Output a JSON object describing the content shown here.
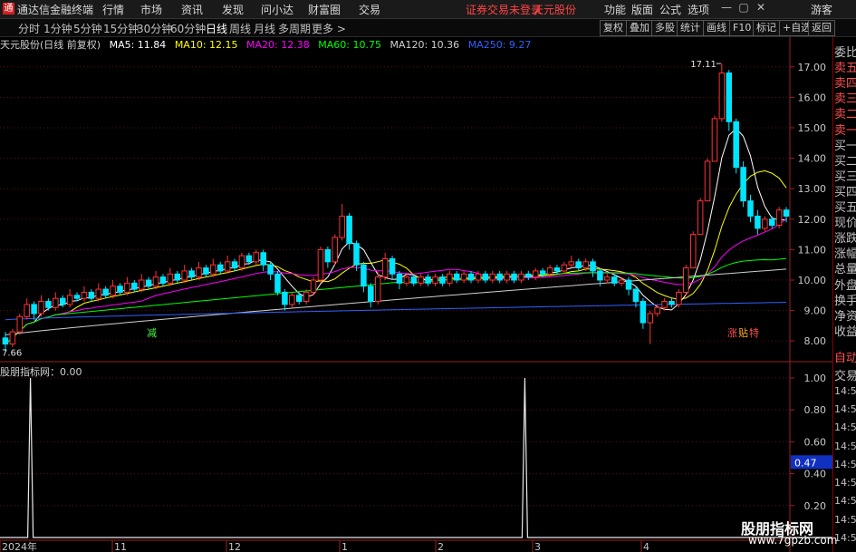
{
  "app": {
    "logo_glyph": "通",
    "title": "通达信金融终端",
    "menu": [
      "行情",
      "市场",
      "资讯",
      "发现",
      "问小达",
      "财富圈",
      "交易"
    ],
    "notice": "证券交易未登录",
    "stock_name_top": "天元股份",
    "right_menu": [
      "功能",
      "版面",
      "公式",
      "选项"
    ],
    "guest": "游客",
    "win_buttons": [
      "—",
      "▢",
      "✕"
    ]
  },
  "periods": {
    "items": [
      "分时",
      "1分钟",
      "5分钟",
      "15分钟",
      "30分钟",
      "60分钟",
      "日线",
      "周线",
      "月线",
      "多周期",
      "更多 >"
    ],
    "active": "日线",
    "tools": [
      "复权",
      "叠加",
      "多股",
      "统计",
      "画线",
      "F10",
      "标记",
      "+自选",
      "返回"
    ]
  },
  "main_chart": {
    "header_title": "天元股份(日线 前复权)",
    "ma": [
      {
        "label": "MA5: 11.84",
        "color": "#ffffff"
      },
      {
        "label": "MA10: 12.15",
        "color": "#ffff00"
      },
      {
        "label": "MA20: 12.38",
        "color": "#ff00ff"
      },
      {
        "label": "MA60: 10.75",
        "color": "#00ff00"
      },
      {
        "label": "MA120: 10.36",
        "color": "#d0d0d0"
      },
      {
        "label": "MA250: 9.27",
        "color": "#3060ff"
      }
    ],
    "y_ticks": [
      "17.00",
      "16.00",
      "15.00",
      "14.00",
      "13.00",
      "12.00",
      "11.00",
      "10.00",
      "9.00",
      "8.00"
    ],
    "high_label": "17.11",
    "low_label": "7.66",
    "tag_left": "减",
    "tag_right": [
      "涨",
      "贴",
      "特"
    ]
  },
  "sub_chart": {
    "header": "股朋指标网：0.00",
    "y_ticks": [
      "1.00",
      "0.80",
      "0.60",
      "0.40",
      "0.20"
    ],
    "current_value": "0.47"
  },
  "x_axis": [
    "2024年",
    "11",
    "12",
    "1",
    "2",
    "3",
    "4"
  ],
  "right_panel": {
    "top_items": [
      "委比",
      "卖五",
      "卖四",
      "卖三",
      "卖二",
      "卖一",
      "买一",
      "买二",
      "买三",
      "买四",
      "买五",
      "现价",
      "涨跌",
      "涨幅",
      "总量",
      "外盘",
      "换手",
      "净资",
      "收益"
    ],
    "bottom_items": [
      "自动",
      "交易",
      "14:56",
      "14:56",
      "14:56",
      "14:56",
      "14:56",
      "14:56",
      "14:56",
      "14:56",
      "14:56"
    ]
  },
  "watermark": {
    "line1": "股朋指标网",
    "line2": "www.7gpzb.com"
  },
  "chart_data": {
    "type": "candlestick",
    "price_range": [
      7.5,
      17.5
    ],
    "candles": [
      {
        "o": 8.1,
        "c": 7.9,
        "h": 8.3,
        "l": 7.66
      },
      {
        "o": 7.9,
        "c": 8.3,
        "h": 8.4,
        "l": 7.8
      },
      {
        "o": 8.3,
        "c": 8.8,
        "h": 8.9,
        "l": 8.2
      },
      {
        "o": 8.8,
        "c": 9.2,
        "h": 9.4,
        "l": 8.7
      },
      {
        "o": 9.2,
        "c": 8.9,
        "h": 9.3,
        "l": 8.7
      },
      {
        "o": 8.9,
        "c": 9.3,
        "h": 9.5,
        "l": 8.8
      },
      {
        "o": 9.3,
        "c": 9.1,
        "h": 9.4,
        "l": 9.0
      },
      {
        "o": 9.1,
        "c": 9.4,
        "h": 9.6,
        "l": 9.0
      },
      {
        "o": 9.4,
        "c": 9.2,
        "h": 9.5,
        "l": 9.1
      },
      {
        "o": 9.2,
        "c": 9.5,
        "h": 9.7,
        "l": 9.1
      },
      {
        "o": 9.5,
        "c": 9.4,
        "h": 9.6,
        "l": 9.3
      },
      {
        "o": 9.4,
        "c": 9.6,
        "h": 9.8,
        "l": 9.3
      },
      {
        "o": 9.6,
        "c": 9.4,
        "h": 9.7,
        "l": 9.3
      },
      {
        "o": 9.4,
        "c": 9.7,
        "h": 9.9,
        "l": 9.3
      },
      {
        "o": 9.7,
        "c": 9.5,
        "h": 9.8,
        "l": 9.4
      },
      {
        "o": 9.5,
        "c": 9.8,
        "h": 10.0,
        "l": 9.4
      },
      {
        "o": 9.8,
        "c": 9.6,
        "h": 9.9,
        "l": 9.5
      },
      {
        "o": 9.6,
        "c": 9.9,
        "h": 10.1,
        "l": 9.5
      },
      {
        "o": 9.9,
        "c": 9.7,
        "h": 10.0,
        "l": 9.6
      },
      {
        "o": 9.7,
        "c": 10.0,
        "h": 10.2,
        "l": 9.6
      },
      {
        "o": 10.0,
        "c": 9.8,
        "h": 10.1,
        "l": 9.7
      },
      {
        "o": 9.8,
        "c": 10.1,
        "h": 10.3,
        "l": 9.7
      },
      {
        "o": 10.1,
        "c": 9.9,
        "h": 10.2,
        "l": 9.8
      },
      {
        "o": 9.9,
        "c": 10.2,
        "h": 10.4,
        "l": 9.8
      },
      {
        "o": 10.2,
        "c": 10.0,
        "h": 10.3,
        "l": 9.9
      },
      {
        "o": 10.0,
        "c": 10.3,
        "h": 10.5,
        "l": 9.9
      },
      {
        "o": 10.3,
        "c": 10.1,
        "h": 10.4,
        "l": 10.0
      },
      {
        "o": 10.1,
        "c": 10.4,
        "h": 10.6,
        "l": 10.0
      },
      {
        "o": 10.4,
        "c": 10.2,
        "h": 10.5,
        "l": 10.1
      },
      {
        "o": 10.2,
        "c": 10.5,
        "h": 10.7,
        "l": 10.1
      },
      {
        "o": 10.5,
        "c": 10.3,
        "h": 10.6,
        "l": 10.2
      },
      {
        "o": 10.3,
        "c": 10.6,
        "h": 10.8,
        "l": 10.2
      },
      {
        "o": 10.6,
        "c": 10.4,
        "h": 10.7,
        "l": 10.3
      },
      {
        "o": 10.4,
        "c": 10.8,
        "h": 10.9,
        "l": 10.3
      },
      {
        "o": 10.8,
        "c": 10.6,
        "h": 10.9,
        "l": 10.5
      },
      {
        "o": 10.6,
        "c": 10.9,
        "h": 11.0,
        "l": 10.5
      },
      {
        "o": 10.9,
        "c": 10.5,
        "h": 11.0,
        "l": 10.3
      },
      {
        "o": 10.5,
        "c": 10.2,
        "h": 10.6,
        "l": 10.0
      },
      {
        "o": 10.2,
        "c": 9.6,
        "h": 10.3,
        "l": 9.5
      },
      {
        "o": 9.6,
        "c": 9.2,
        "h": 9.7,
        "l": 9.0
      },
      {
        "o": 9.2,
        "c": 9.5,
        "h": 9.6,
        "l": 9.1
      },
      {
        "o": 9.5,
        "c": 9.3,
        "h": 9.6,
        "l": 9.2
      },
      {
        "o": 9.3,
        "c": 9.6,
        "h": 9.7,
        "l": 9.2
      },
      {
        "o": 9.6,
        "c": 10.0,
        "h": 10.1,
        "l": 9.5
      },
      {
        "o": 10.0,
        "c": 11.0,
        "h": 11.1,
        "l": 9.9
      },
      {
        "o": 11.0,
        "c": 10.6,
        "h": 11.1,
        "l": 10.4
      },
      {
        "o": 10.6,
        "c": 11.4,
        "h": 11.5,
        "l": 10.5
      },
      {
        "o": 11.4,
        "c": 12.1,
        "h": 12.5,
        "l": 11.3
      },
      {
        "o": 12.1,
        "c": 11.2,
        "h": 12.2,
        "l": 11.0
      },
      {
        "o": 11.2,
        "c": 10.5,
        "h": 11.3,
        "l": 10.3
      },
      {
        "o": 10.5,
        "c": 9.8,
        "h": 10.6,
        "l": 9.6
      },
      {
        "o": 9.8,
        "c": 9.3,
        "h": 9.9,
        "l": 9.1
      },
      {
        "o": 9.3,
        "c": 10.1,
        "h": 10.3,
        "l": 9.2
      },
      {
        "o": 10.1,
        "c": 10.7,
        "h": 10.9,
        "l": 10.0
      },
      {
        "o": 10.7,
        "c": 10.2,
        "h": 10.8,
        "l": 10.0
      },
      {
        "o": 10.2,
        "c": 9.9,
        "h": 10.3,
        "l": 9.7
      },
      {
        "o": 9.9,
        "c": 10.1,
        "h": 10.2,
        "l": 9.8
      },
      {
        "o": 10.1,
        "c": 9.9,
        "h": 10.2,
        "l": 9.8
      },
      {
        "o": 9.9,
        "c": 10.1,
        "h": 10.2,
        "l": 9.8
      },
      {
        "o": 10.1,
        "c": 9.9,
        "h": 10.2,
        "l": 9.8
      },
      {
        "o": 9.9,
        "c": 10.1,
        "h": 10.2,
        "l": 9.8
      },
      {
        "o": 10.1,
        "c": 9.9,
        "h": 10.2,
        "l": 9.8
      },
      {
        "o": 9.9,
        "c": 10.2,
        "h": 10.3,
        "l": 9.8
      },
      {
        "o": 10.2,
        "c": 10.0,
        "h": 10.3,
        "l": 9.9
      },
      {
        "o": 10.0,
        "c": 10.2,
        "h": 10.3,
        "l": 9.9
      },
      {
        "o": 10.2,
        "c": 10.0,
        "h": 10.3,
        "l": 9.9
      },
      {
        "o": 10.0,
        "c": 10.2,
        "h": 10.3,
        "l": 9.9
      },
      {
        "o": 10.2,
        "c": 10.0,
        "h": 10.3,
        "l": 9.9
      },
      {
        "o": 10.0,
        "c": 10.2,
        "h": 10.3,
        "l": 9.9
      },
      {
        "o": 10.2,
        "c": 10.0,
        "h": 10.3,
        "l": 9.9
      },
      {
        "o": 10.0,
        "c": 10.2,
        "h": 10.3,
        "l": 9.9
      },
      {
        "o": 10.2,
        "c": 10.0,
        "h": 10.3,
        "l": 9.9
      },
      {
        "o": 10.0,
        "c": 10.2,
        "h": 10.3,
        "l": 9.9
      },
      {
        "o": 10.2,
        "c": 10.1,
        "h": 10.3,
        "l": 10.0
      },
      {
        "o": 10.1,
        "c": 10.3,
        "h": 10.4,
        "l": 10.0
      },
      {
        "o": 10.3,
        "c": 10.2,
        "h": 10.4,
        "l": 10.1
      },
      {
        "o": 10.2,
        "c": 10.4,
        "h": 10.5,
        "l": 10.1
      },
      {
        "o": 10.4,
        "c": 10.3,
        "h": 10.5,
        "l": 10.2
      },
      {
        "o": 10.3,
        "c": 10.5,
        "h": 10.6,
        "l": 10.2
      },
      {
        "o": 10.5,
        "c": 10.6,
        "h": 10.8,
        "l": 10.4
      },
      {
        "o": 10.6,
        "c": 10.4,
        "h": 10.7,
        "l": 10.3
      },
      {
        "o": 10.4,
        "c": 10.6,
        "h": 10.7,
        "l": 10.3
      },
      {
        "o": 10.6,
        "c": 10.3,
        "h": 10.7,
        "l": 10.1
      },
      {
        "o": 10.3,
        "c": 10.0,
        "h": 10.4,
        "l": 9.8
      },
      {
        "o": 10.0,
        "c": 10.1,
        "h": 10.2,
        "l": 9.9
      },
      {
        "o": 10.1,
        "c": 9.9,
        "h": 10.2,
        "l": 9.8
      },
      {
        "o": 9.9,
        "c": 10.0,
        "h": 10.1,
        "l": 9.8
      },
      {
        "o": 10.0,
        "c": 9.7,
        "h": 10.1,
        "l": 9.5
      },
      {
        "o": 9.7,
        "c": 9.3,
        "h": 9.8,
        "l": 9.1
      },
      {
        "o": 9.3,
        "c": 8.6,
        "h": 9.4,
        "l": 8.4
      },
      {
        "o": 8.6,
        "c": 8.9,
        "h": 9.0,
        "l": 7.9
      },
      {
        "o": 8.9,
        "c": 9.1,
        "h": 9.2,
        "l": 8.8
      },
      {
        "o": 9.1,
        "c": 9.3,
        "h": 9.4,
        "l": 9.0
      },
      {
        "o": 9.3,
        "c": 9.2,
        "h": 9.4,
        "l": 9.1
      },
      {
        "o": 9.2,
        "c": 9.6,
        "h": 9.7,
        "l": 9.1
      },
      {
        "o": 9.6,
        "c": 10.4,
        "h": 10.5,
        "l": 9.5
      },
      {
        "o": 10.4,
        "c": 11.5,
        "h": 11.6,
        "l": 10.4
      },
      {
        "o": 11.5,
        "c": 12.6,
        "h": 12.7,
        "l": 11.5
      },
      {
        "o": 12.6,
        "c": 13.9,
        "h": 14.0,
        "l": 12.6
      },
      {
        "o": 13.9,
        "c": 15.3,
        "h": 15.4,
        "l": 13.9
      },
      {
        "o": 15.3,
        "c": 16.8,
        "h": 17.11,
        "l": 15.2
      },
      {
        "o": 16.8,
        "c": 15.2,
        "h": 16.9,
        "l": 14.9
      },
      {
        "o": 15.2,
        "c": 13.7,
        "h": 15.3,
        "l": 13.5
      },
      {
        "o": 13.7,
        "c": 12.6,
        "h": 13.9,
        "l": 12.4
      },
      {
        "o": 12.6,
        "c": 12.1,
        "h": 12.8,
        "l": 11.9
      },
      {
        "o": 12.1,
        "c": 11.7,
        "h": 12.3,
        "l": 11.5
      },
      {
        "o": 11.7,
        "c": 12.0,
        "h": 12.1,
        "l": 11.6
      },
      {
        "o": 12.0,
        "c": 11.8,
        "h": 12.1,
        "l": 11.7
      },
      {
        "o": 11.8,
        "c": 12.3,
        "h": 12.4,
        "l": 11.7
      },
      {
        "o": 12.3,
        "c": 12.1,
        "h": 12.4,
        "l": 11.9
      }
    ],
    "indicator_spikes_at": [
      4,
      73,
      147,
      151
    ]
  }
}
